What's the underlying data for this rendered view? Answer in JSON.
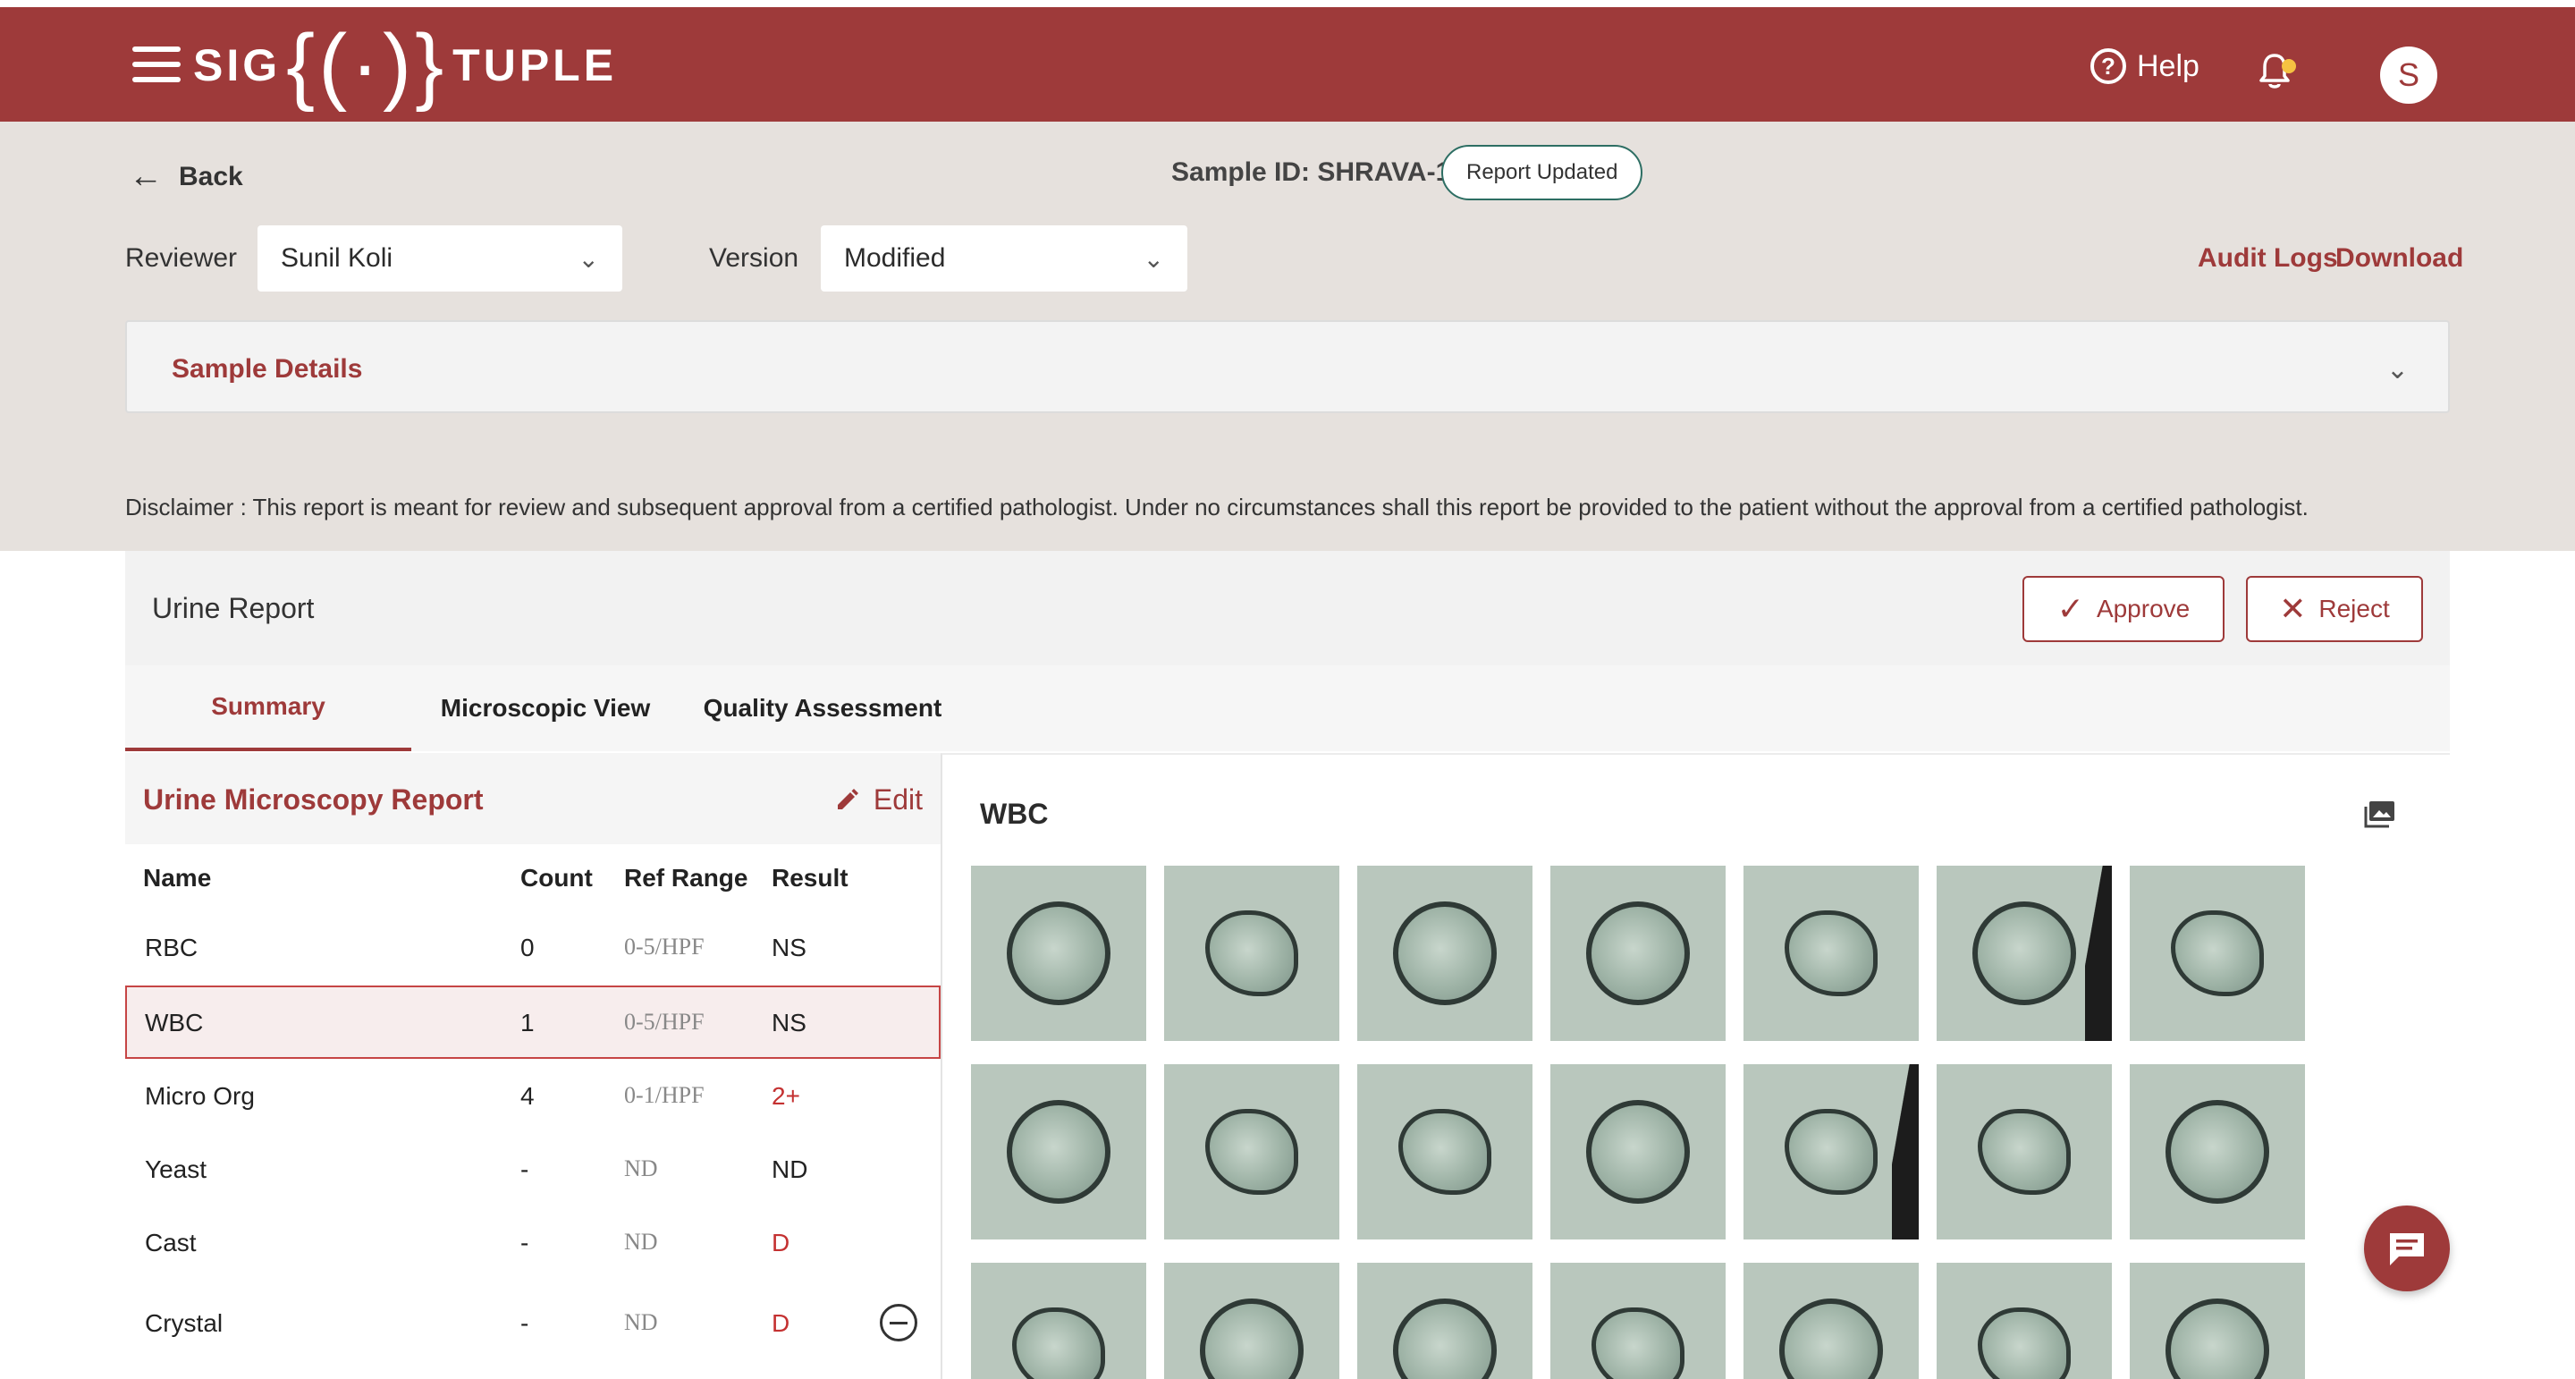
{
  "header": {
    "logo_text_left": "SIG",
    "logo_mark": "{(·)}",
    "logo_text_right": "TUPLE",
    "help_label": "Help",
    "help_icon": "question-circle-icon",
    "notification_icon": "bell-icon",
    "avatar_initial": "S"
  },
  "toolbar": {
    "back_label": "Back",
    "sample_id": "Sample ID: SHRAVA-1",
    "status_badge": "Report Updated",
    "reviewer_label": "Reviewer",
    "reviewer_value": "Sunil Koli",
    "version_label": "Version",
    "version_value": "Modified",
    "audit_logs": "Audit Logs",
    "download": "Download"
  },
  "sample_details": {
    "title": "Sample Details"
  },
  "disclaimer": "Disclaimer :  This report is meant for review and subsequent approval from a certified pathologist. Under no circumstances shall this report be provided to the patient without the approval from a certified pathologist.",
  "report": {
    "title": "Urine Report",
    "approve_label": "Approve",
    "reject_label": "Reject",
    "tabs": [
      {
        "label": "Summary",
        "active": true
      },
      {
        "label": "Microscopic View",
        "active": false
      },
      {
        "label": "Quality Assessment",
        "active": false
      }
    ]
  },
  "microscopy": {
    "title": "Urine Microscopy Report",
    "edit_label": "Edit",
    "columns": [
      "Name",
      "Count",
      "Ref Range",
      "Result"
    ],
    "rows": [
      {
        "name": "RBC",
        "count": "0",
        "ref": "0-5/HPF",
        "result": "NS"
      },
      {
        "name": "WBC",
        "count": "1",
        "ref": "0-5/HPF",
        "result": "NS"
      },
      {
        "name": "Micro Org",
        "count": "4",
        "ref": "0-1/HPF",
        "result": "2+"
      },
      {
        "name": "Yeast",
        "count": "-",
        "ref": "ND",
        "result": "ND"
      },
      {
        "name": "Cast",
        "count": "-",
        "ref": "ND",
        "result": "D"
      },
      {
        "name": "Crystal",
        "count": "-",
        "ref": "ND",
        "result": "D"
      }
    ],
    "selected_row": "WBC"
  },
  "viewer": {
    "title": "WBC",
    "gallery_icon": "image-gallery-icon"
  },
  "chat_icon": "chat-icon",
  "colors": {
    "brand": "#9e3a3a",
    "band": "#e6e1dd",
    "result_red": "#c43131",
    "badge_border": "#2d6e63"
  }
}
